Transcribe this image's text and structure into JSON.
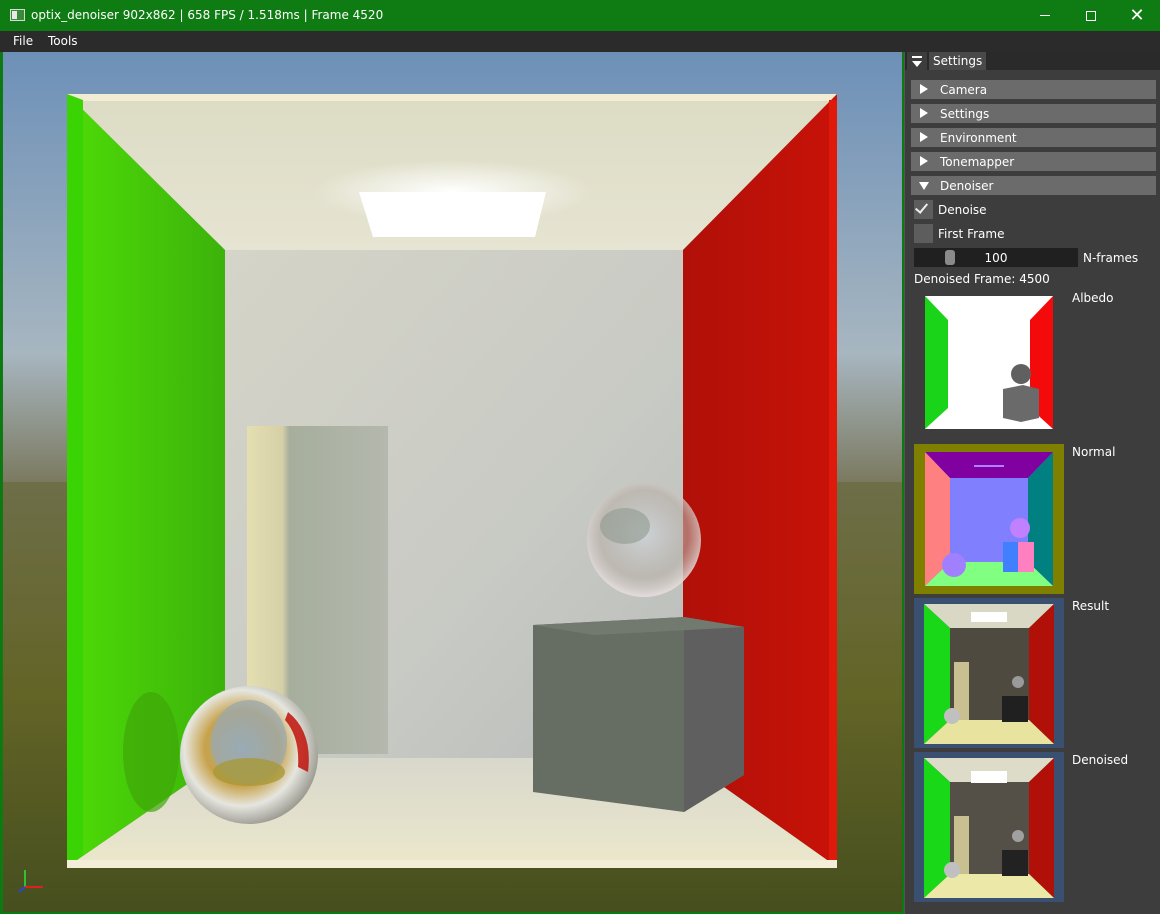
{
  "window": {
    "title": "optix_denoiser 902x862 | 658 FPS / 1.518ms | Frame 4520"
  },
  "menu": {
    "file": "File",
    "tools": "Tools"
  },
  "panel": {
    "tab": "Settings",
    "sections": [
      {
        "label": "Camera",
        "expanded": false
      },
      {
        "label": "Settings",
        "expanded": false
      },
      {
        "label": "Environment",
        "expanded": false
      },
      {
        "label": "Tonemapper",
        "expanded": false
      },
      {
        "label": "Denoiser",
        "expanded": true
      }
    ],
    "denoiser": {
      "denoise_label": "Denoise",
      "denoise_checked": true,
      "first_frame_label": "First Frame",
      "first_frame_checked": false,
      "nframes_value": "100",
      "nframes_label": "N-frames",
      "denoised_frame": "Denoised Frame: 4500",
      "buffers": [
        {
          "label": "Albedo",
          "icon": "albedo-buffer-image"
        },
        {
          "label": "Normal",
          "icon": "normal-buffer-image"
        },
        {
          "label": "Result",
          "icon": "result-buffer-image"
        },
        {
          "label": "Denoised",
          "icon": "denoised-buffer-image"
        }
      ]
    }
  },
  "colors": {
    "title_bar": "#0e7c12",
    "menu_bar": "#2b2b2b",
    "panel_bg": "#3d3d3d",
    "header_bg": "#6b6b6b"
  }
}
